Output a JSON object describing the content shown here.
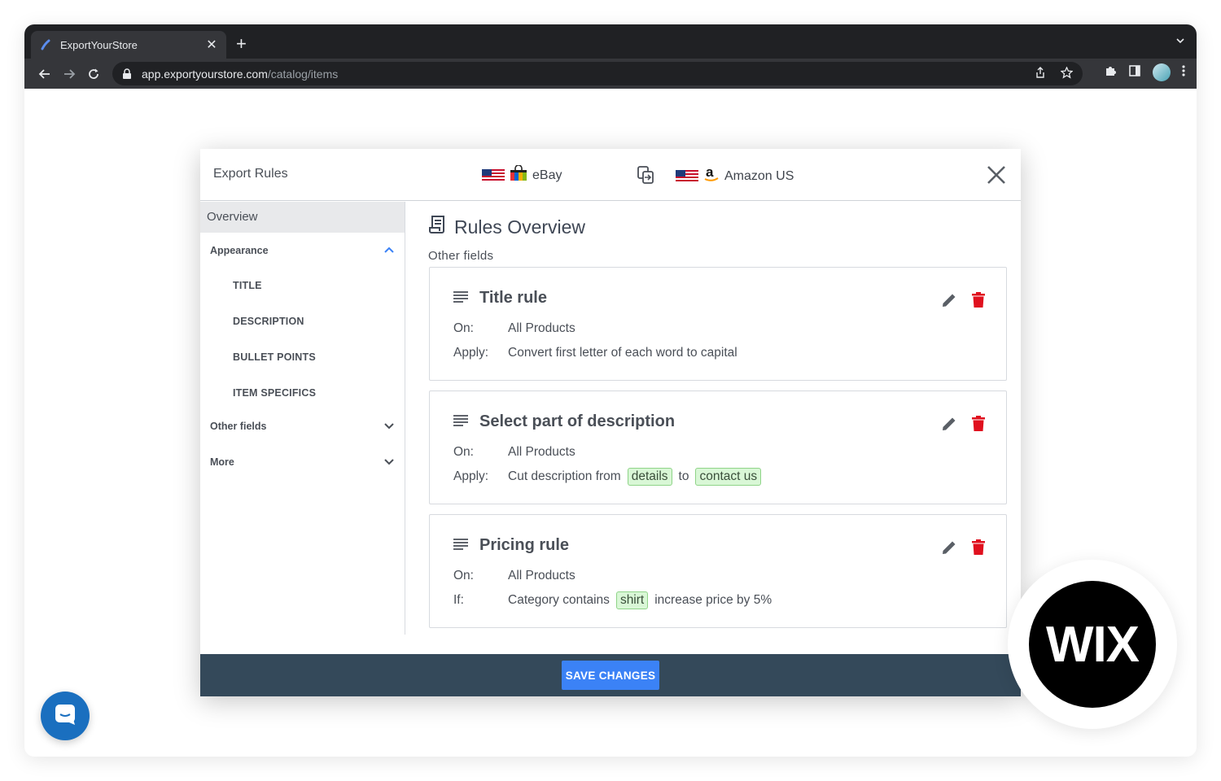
{
  "browser": {
    "tab_title": "ExportYourStore",
    "url_host": "app.exportyourstore.com",
    "url_path": "/catalog/items"
  },
  "modal": {
    "title": "Export Rules",
    "source_channel": "eBay",
    "target_channel": "Amazon US",
    "save_label": "SAVE CHANGES"
  },
  "sidebar": {
    "overview": "Overview",
    "sections": [
      {
        "label": "Appearance",
        "expanded": true,
        "items": [
          "TITLE",
          "DESCRIPTION",
          "BULLET POINTS",
          "ITEM SPECIFICS"
        ]
      },
      {
        "label": "Other fields",
        "expanded": false
      },
      {
        "label": "More",
        "expanded": false
      }
    ]
  },
  "content": {
    "title": "Rules Overview",
    "section_label": "Other fields",
    "rules": [
      {
        "name": "Title rule",
        "on_key": "On:",
        "on_value": "All Products",
        "apply_key": "Apply:",
        "apply_text": "Convert first letter of each word to capital"
      },
      {
        "name": "Select part of description",
        "on_key": "On:",
        "on_value": "All Products",
        "apply_key": "Apply:",
        "apply_prefix": "Cut description from",
        "chip1": "details",
        "mid": "to",
        "chip2": "contact us"
      },
      {
        "name": "Pricing rule",
        "on_key": "On:",
        "on_value": "All Products",
        "if_key": "If:",
        "if_prefix": "Category contains",
        "chip": "shirt",
        "if_suffix": "increase price by 5%"
      }
    ]
  },
  "badges": {
    "wix": "WIX"
  },
  "colors": {
    "footer": "#34495a",
    "save_button": "#3b82f6",
    "delete_icon": "#e0101e",
    "chip_bg": "#d9f7d6"
  }
}
